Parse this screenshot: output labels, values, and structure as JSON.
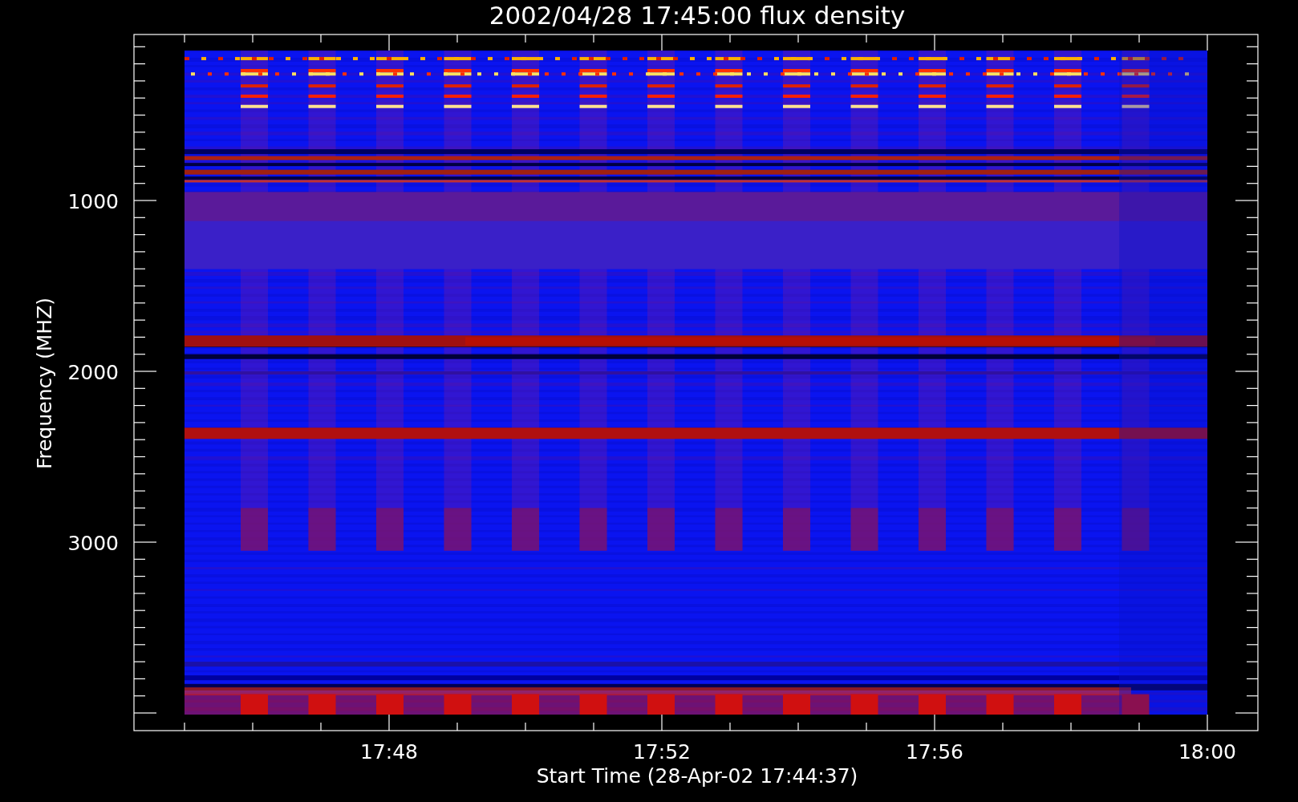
{
  "title": "2002/04/28 17:45:00 flux density",
  "x_axis": {
    "label": "Start Time (28-Apr-02 17:44:37)",
    "ticks": [
      "17:48",
      "17:52",
      "17:56",
      "18:00"
    ]
  },
  "y_axis": {
    "label": "Frequency (MHZ)",
    "ticks": [
      "1000",
      "2000",
      "3000"
    ]
  }
}
